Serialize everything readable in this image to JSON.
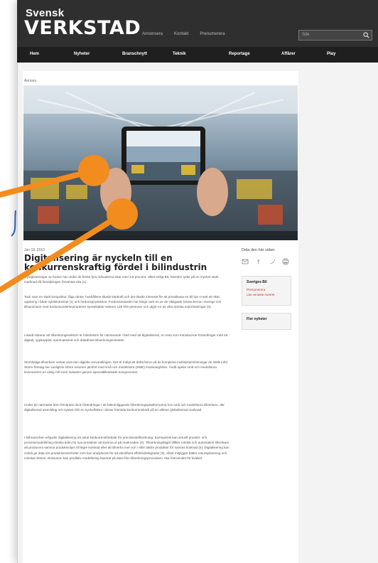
{
  "site": {
    "logo_line1": "Svensk",
    "logo_line2": "VERKSTAD",
    "top_links": [
      "Annonsera",
      "Kontakt",
      "Prenumerera"
    ],
    "search_placeholder": "Sök"
  },
  "nav": {
    "items": [
      "Hem",
      "Nyheter",
      "Branschnytt",
      "Teknik",
      "Reportage",
      "Affärer",
      "Play"
    ]
  },
  "article": {
    "breadcrumb": "Annons",
    "date": "Jan 18, 2019",
    "title_line1": "Digitalisering är nyckeln till en",
    "title_line2": "konkurrenskraftig fördel i bilindustrin",
    "paragraphs": [
      "Nyregistreringar av fordon har under de första fyra månaderna ökat med 3,6 procent, vilket enligt BIL Sweden tyder på en mycket stark marknad då försäljningen förväntas öka (1).",
      "Tack vare en stark konjunktur, låga räntor, hushållens ökade köpkraft och det ökade intresset för att privatleasa en bil har vi sett ett ökat uppsving i både nybilsintresset (1) och fordonsproduktion. Fordonsindustrin har länge varit en av de viktigaste branscherna i Sverige och tillsammans med fordonsunderleverantörer sysselsätter sektorn 135 000 personer och utgör en av våra största exportnäringar (3).",
      "Likaså riskerar att tillverkningssektorn är bilindustrin för närvarande i färd med att digitaliseras, en resa som introducerar förändringar med ett digitalt, uppkopplat, automatiserat och datadrivet tillverkningsmönster.",
      "Storskaliga tillverkare verkar vara den digitala omvandlingen. Det är troligt att detta beror på de komplexa multisystemlösningar de ställs inför. Större företag har vanligtvis större resurser jämfört med små och medelstora (SME) motsvarigheter. Ändå spelar små och medelstora leverantörer en viktig roll inom industrin genom specialtillverkade komponenter.",
      "Under de närmaste åren förväntas dock förändringar i de bakomliggande tillverkningsplattformarna hos små och medelstora tillverkare, där digitaliserad utveckling och system blir en nyckelfaktor i deras framtida konkurrenskraft på en alltmer globaliserad marknad.",
      "I bilbranschen erbjuder digitalisering ett antal konkurrensfördelar för precisionstillverkning. Exempelvis kan virtuell produkt- och processmodellering minska tiden för nya produkter att komma ut på marknaden (4). Tillverkningsläget tillåter robotik och automation tillverkare att producera samma produktvolym till lägre kostnad eller att tillverka mer och / eller bättre produkter för samma kostnad (5). Digitalisering kan också ge data om produktionsenheter som kan analyseras för att identifiera effektivitetsgrader (6), vilket möjliggör bättre resursplanering och minskat slöseri. Dessutom kan prediktiv modellering baserat på data från tillverkningsprocessen, öka förtroendet för kvalitet."
    ]
  },
  "sidebar": {
    "share_label": "Dela den här sidan:",
    "share_icons": [
      "email-icon",
      "facebook-icon",
      "twitter-icon",
      "print-icon"
    ],
    "box1_title": "Sveriges Bil",
    "box1_links": [
      "Prenumerera",
      "Läs senaste numret"
    ],
    "box2_title": "Fler nyheter"
  },
  "colors": {
    "topbar": "#2f2f2f",
    "navbar": "#1f1f1f",
    "callout": "#f28c1e"
  }
}
